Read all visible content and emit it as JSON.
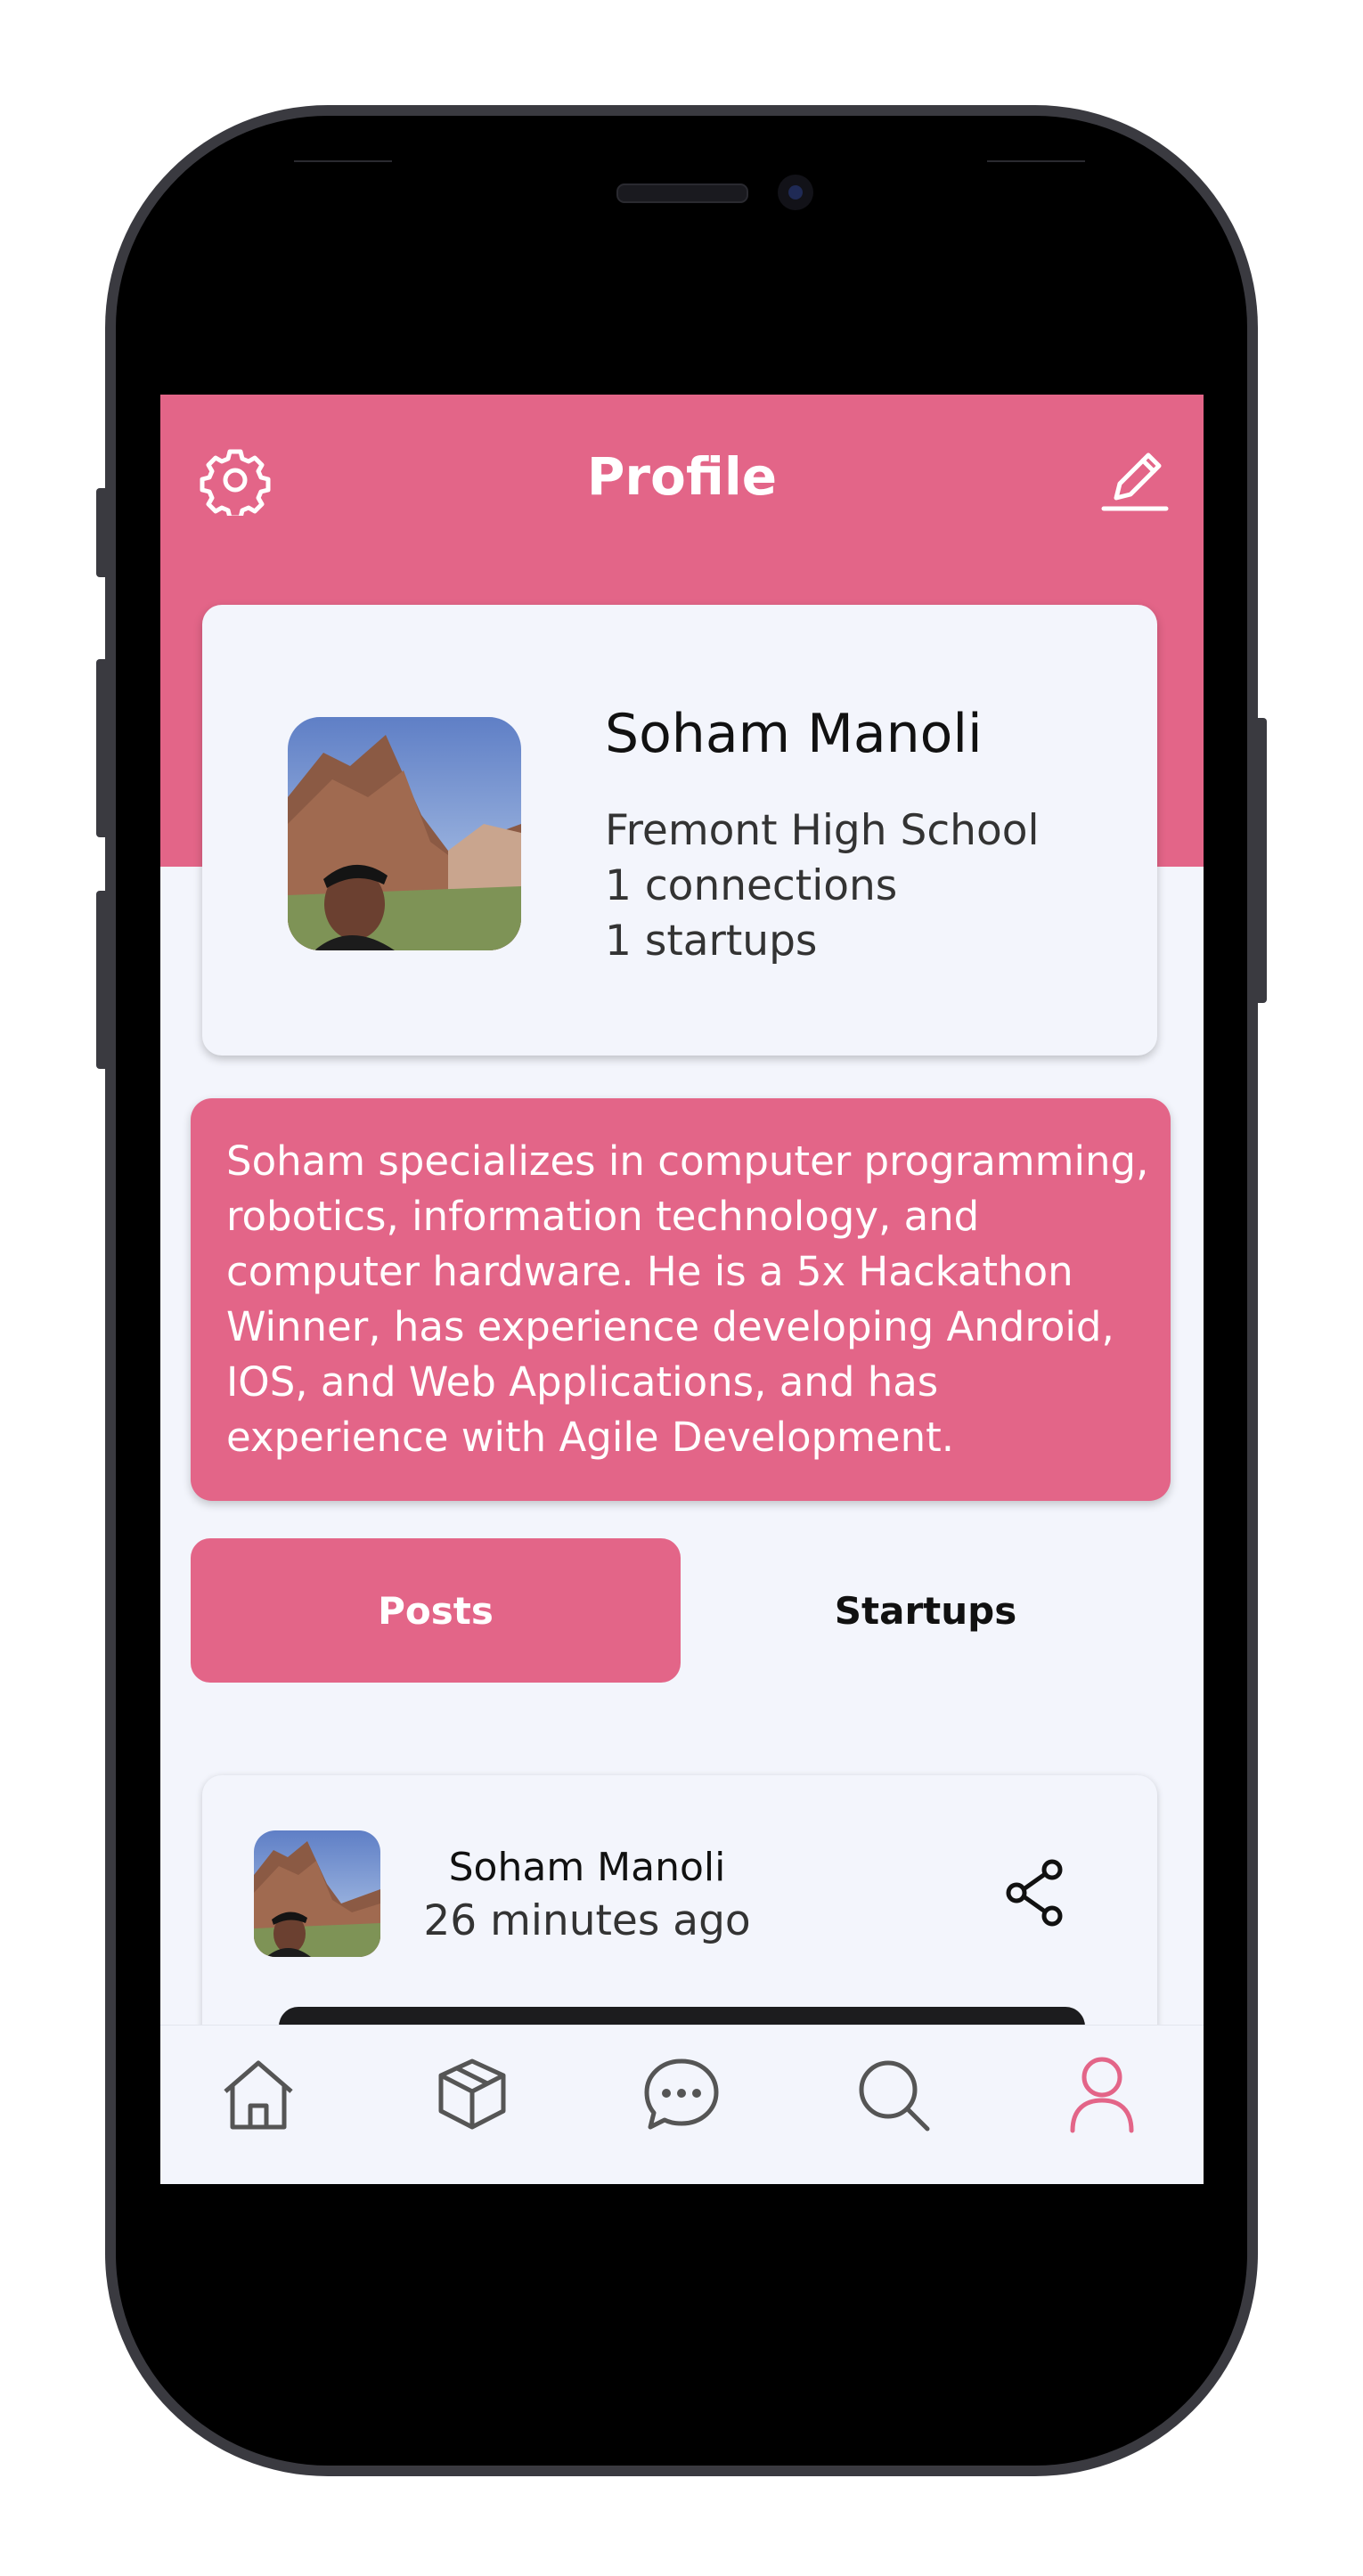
{
  "colors": {
    "accent": "#e36588",
    "background": "#f3f5fc",
    "active_nav": "#e36588",
    "inactive_nav": "#555555"
  },
  "appbar": {
    "title": "Profile",
    "left_icon": "settings-gear-icon",
    "right_icon": "edit-pencil-icon"
  },
  "profile": {
    "name": "Soham Manoli",
    "school": "Fremont High School",
    "connections": "1 connections",
    "startups": "1 startups"
  },
  "bio": "Soham specializes in computer programming, robotics, information technology, and computer hardware. He is a 5x Hackathon Winner, has experience developing Android, IOS, and Web Applications, and has experience with Agile Development.",
  "tabs": [
    {
      "label": "Posts",
      "selected": true
    },
    {
      "label": "Startups",
      "selected": false
    }
  ],
  "post": {
    "author": "Soham Manoli",
    "time": "26 minutes ago",
    "action_icon": "share-icon"
  },
  "bottom_nav": [
    {
      "icon": "home-icon",
      "active": false
    },
    {
      "icon": "cube-icon",
      "active": false
    },
    {
      "icon": "chat-bubble-icon",
      "active": false
    },
    {
      "icon": "search-icon",
      "active": false
    },
    {
      "icon": "person-icon",
      "active": true
    }
  ]
}
